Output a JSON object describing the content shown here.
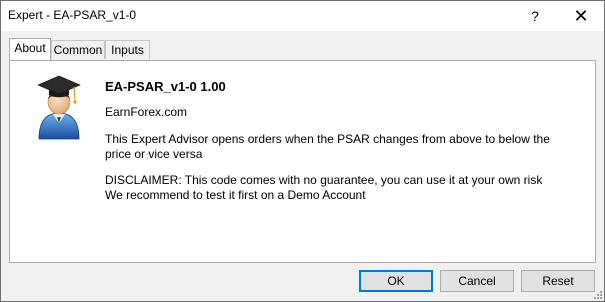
{
  "window": {
    "title": "Expert - EA-PSAR_v1-0",
    "help_glyph": "?",
    "close_glyph": "✕"
  },
  "tabs": [
    {
      "label": "About",
      "active": true
    },
    {
      "label": "Common",
      "active": false
    },
    {
      "label": "Inputs",
      "active": false
    }
  ],
  "about": {
    "heading": "EA-PSAR_v1-0 1.00",
    "company": "EarnForex.com",
    "description": "This Expert Advisor opens orders when the PSAR changes from above to below the price or vice versa",
    "disclaimer_line1": "DISCLAIMER: This code comes with no guarantee, you can use it at your own risk",
    "disclaimer_line2": "We recommend to test it first on a Demo Account"
  },
  "buttons": {
    "ok": "OK",
    "cancel": "Cancel",
    "reset": "Reset"
  },
  "colors": {
    "accent": "#0078d7",
    "panel_bg": "#ffffff",
    "dialog_bg": "#f0f0f0"
  }
}
